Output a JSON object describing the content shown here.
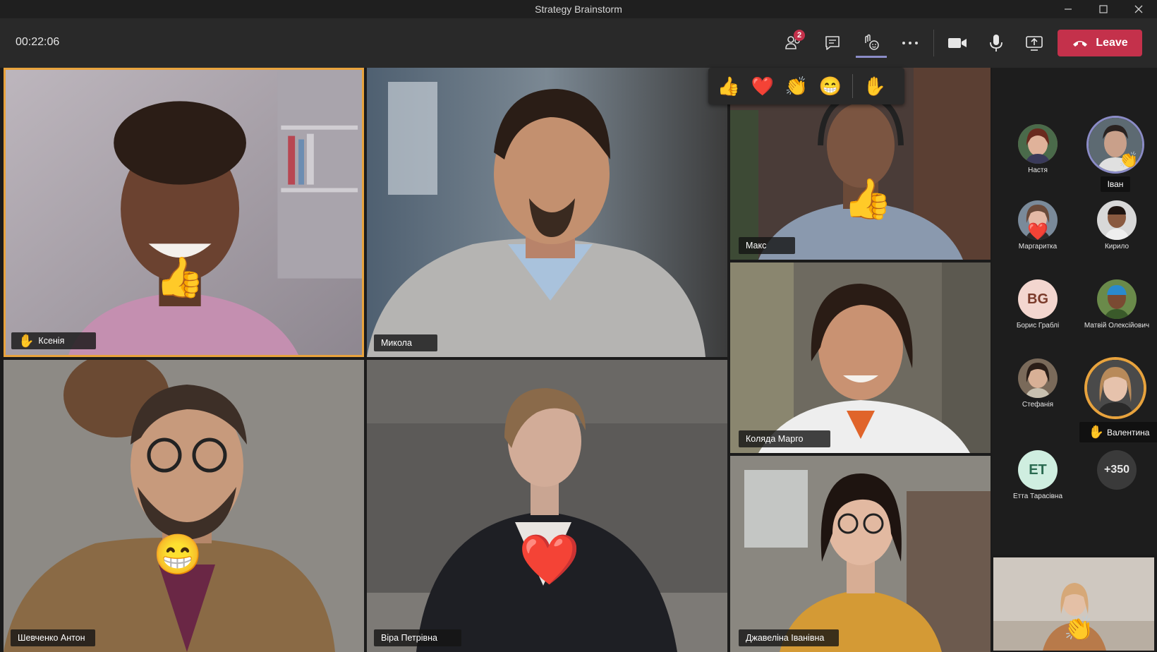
{
  "window": {
    "title": "Strategy Brainstorm"
  },
  "toolbar": {
    "timer": "00:22:06",
    "participants_badge": "2",
    "leave_label": "Leave"
  },
  "reactions_bar": {
    "items": [
      "👍",
      "❤️",
      "👏",
      "😁"
    ],
    "raise_hand": "✋"
  },
  "tiles": [
    {
      "name": "Ксенія",
      "hand": "✋",
      "reaction": "👍"
    },
    {
      "name": "Микола"
    },
    {
      "name": "Макс",
      "reaction": "👍"
    },
    {
      "name": "Коляда Марго"
    },
    {
      "name": "Шевченко Антон",
      "reaction": "😁"
    },
    {
      "name": "Віра Петрівна",
      "reaction": "❤️"
    },
    {
      "name": "Джавеліна Іванівна"
    }
  ],
  "roster": [
    {
      "name": "Настя"
    },
    {
      "name": "Іван",
      "reaction": "👏"
    },
    {
      "name": "Маргаритка",
      "reaction": "❤️"
    },
    {
      "name": "Кирило"
    },
    {
      "name": "Борис Граблі",
      "initials": "BG"
    },
    {
      "name": "Матвій Олексійович"
    },
    {
      "name": "Стефанія"
    },
    {
      "name": "Валентина",
      "hand": "✋"
    },
    {
      "name": "Етта Тарасівна",
      "initials": "ET"
    },
    {
      "overflow": "+350"
    }
  ],
  "self_view": {
    "reaction": "👏"
  },
  "colors": {
    "leave": "#c4314b",
    "highlight": "#e8a33d",
    "active_ring": "#8b8cc7",
    "badge": "#c4314b"
  }
}
